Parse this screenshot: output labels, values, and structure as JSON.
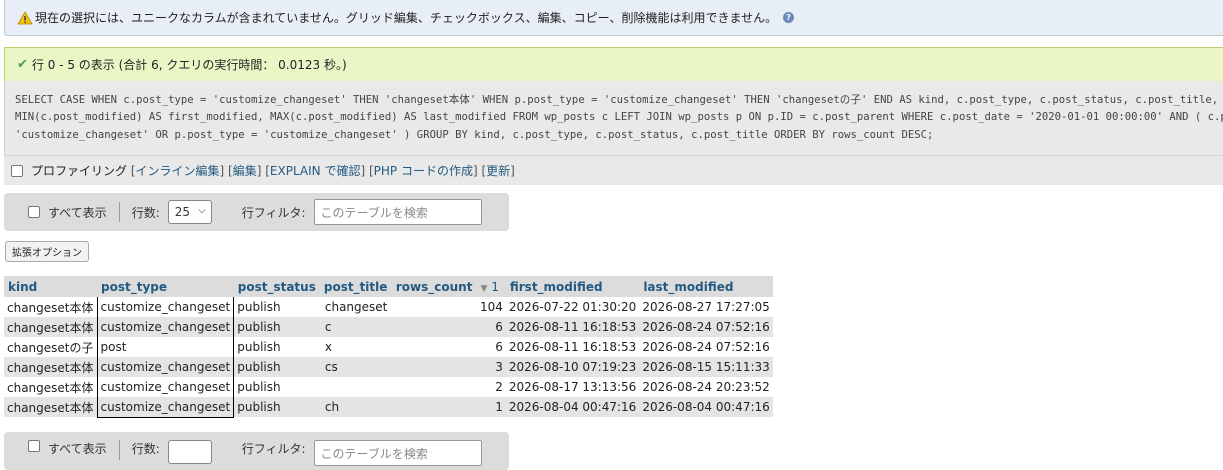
{
  "notice": {
    "text": "現在の選択には、ユニークなカラムが含まれていません。グリッド編集、チェックボックス、編集、コピー、削除機能は利用できません。",
    "help": "?"
  },
  "success": {
    "text": "行 0 - 5 の表示 (合計 6, クエリの実行時間： 0.0123 秒。)"
  },
  "query": {
    "line1": "SELECT CASE WHEN c.post_type = 'customize_changeset' THEN 'changeset本体' WHEN p.post_type = 'customize_changeset' THEN 'changesetの子' END AS kind, c.post_type, c.post_status, c.post_title, COUNT(*) AS ro",
    "line2": "MIN(c.post_modified) AS first_modified, MAX(c.post_modified) AS last_modified FROM wp_posts c LEFT JOIN wp_posts p ON p.ID = c.post_parent WHERE c.post_date = '2020-01-01 00:00:00' AND ( c.post_type =",
    "line3": "'customize_changeset' OR p.post_type = 'customize_changeset' ) GROUP BY kind, c.post_type, c.post_status, c.post_title ORDER BY rows_count DESC;"
  },
  "profiling": {
    "label": "プロファイリング",
    "links": [
      "インライン編集",
      "編集",
      "EXPLAIN で確認",
      "PHP コードの作成",
      "更新"
    ]
  },
  "navbar": {
    "show_all": "すべて表示",
    "rows_label": "行数:",
    "rows_value": "25",
    "filter_label": "行フィルタ:",
    "filter_placeholder": "このテーブルを検索"
  },
  "extended_options": "拡張オプション",
  "table": {
    "columns": [
      "kind",
      "post_type",
      "post_status",
      "post_title",
      "rows_count",
      "first_modified",
      "last_modified"
    ],
    "sort_index": "1",
    "rows": [
      [
        "changeset本体",
        "customize_changeset",
        "publish",
        "changeset",
        "104",
        "2026-07-22 01:30:20",
        "2026-08-27 17:27:05"
      ],
      [
        "changeset本体",
        "customize_changeset",
        "publish",
        "c",
        "6",
        "2026-08-11 16:18:53",
        "2026-08-24 07:52:16"
      ],
      [
        "changesetの子",
        "post",
        "publish",
        "x",
        "6",
        "2026-08-11 16:18:53",
        "2026-08-24 07:52:16"
      ],
      [
        "changeset本体",
        "customize_changeset",
        "publish",
        "cs",
        "3",
        "2026-08-10 07:19:23",
        "2026-08-15 15:11:33"
      ],
      [
        "changeset本体",
        "customize_changeset",
        "publish",
        "",
        "2",
        "2026-08-17 13:13:56",
        "2026-08-24 20:23:52"
      ],
      [
        "changeset本体",
        "customize_changeset",
        "publish",
        "ch",
        "1",
        "2026-08-04 00:47:16",
        "2026-08-04 00:47:16"
      ]
    ]
  },
  "navbar_bottom": {
    "show_all": "すべて表示",
    "rows_label": "行数:",
    "filter_label": "行フィルタ:",
    "filter_placeholder": "このテーブルを検索"
  }
}
